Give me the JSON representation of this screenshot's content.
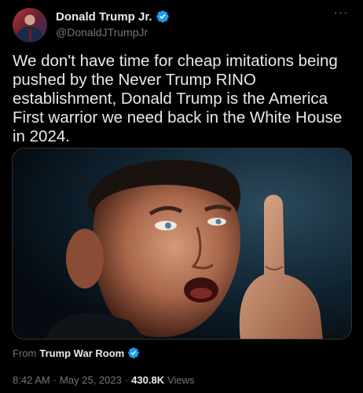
{
  "author": {
    "display_name": "Donald Trump Jr.",
    "handle": "@DonaldJTrumpJr"
  },
  "more_label": "···",
  "tweet": {
    "text": "We don't have time for cheap imitations being pushed by the Never Trump RINO establishment, Donald Trump is the America First warrior we need back in the White House in 2024."
  },
  "attribution": {
    "prefix": "From",
    "source": "Trump War Room"
  },
  "meta": {
    "time": "8:42 AM",
    "separator1": "·",
    "date": "May 25, 2023",
    "separator2": "·",
    "views_count": "430.8K",
    "views_label": "Views"
  },
  "colors": {
    "background": "#000000",
    "text_primary": "#e7e9ea",
    "text_secondary": "#71767b",
    "verified_blue": "#1d9bf0"
  },
  "icons": {
    "verified": "verified-badge-icon",
    "more": "more-horizontal-icon"
  }
}
